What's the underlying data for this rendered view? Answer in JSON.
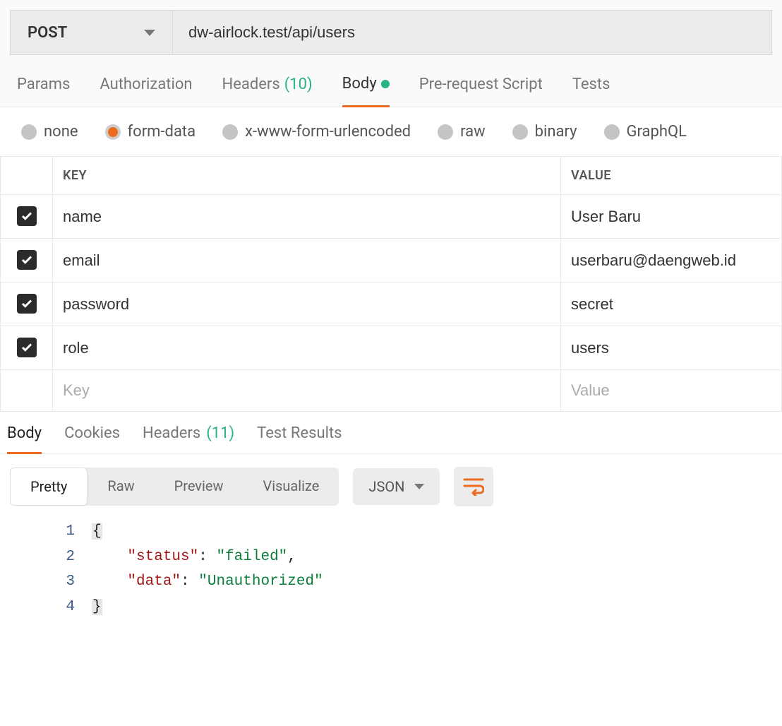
{
  "request": {
    "method": "POST",
    "url": "dw-airlock.test/api/users"
  },
  "reqTabs": {
    "params": "Params",
    "authorization": "Authorization",
    "headers": "Headers",
    "headersCount": "(10)",
    "body": "Body",
    "preRequest": "Pre-request Script",
    "tests": "Tests"
  },
  "bodyTypes": {
    "none": "none",
    "formData": "form-data",
    "urlencoded": "x-www-form-urlencoded",
    "raw": "raw",
    "binary": "binary",
    "graphql": "GraphQL"
  },
  "formTable": {
    "keyHeader": "KEY",
    "valueHeader": "VALUE",
    "rows": [
      {
        "key": "name",
        "value": "User Baru"
      },
      {
        "key": "email",
        "value": "userbaru@daengweb.id"
      },
      {
        "key": "password",
        "value": "secret"
      },
      {
        "key": "role",
        "value": "users"
      }
    ],
    "keyPlaceholder": "Key",
    "valuePlaceholder": "Value"
  },
  "respTabs": {
    "body": "Body",
    "cookies": "Cookies",
    "headers": "Headers",
    "headersCount": "(11)",
    "testResults": "Test Results"
  },
  "respToolbar": {
    "pretty": "Pretty",
    "raw": "Raw",
    "preview": "Preview",
    "visualize": "Visualize",
    "lang": "JSON"
  },
  "responseCode": {
    "lineNumbers": [
      "1",
      "2",
      "3",
      "4"
    ],
    "openBrace": "{",
    "closeBrace": "}",
    "indent": "    ",
    "key1": "\"status\"",
    "val1": "\"failed\"",
    "comma": ",",
    "key2": "\"data\"",
    "val2": "\"Unauthorized\"",
    "colon": ": "
  }
}
